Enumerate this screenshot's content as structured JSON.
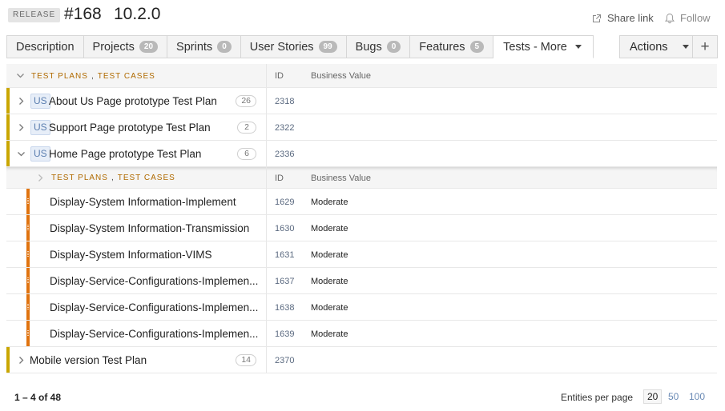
{
  "header": {
    "badge": "RELEASE",
    "id": "#168",
    "name": "10.2.0",
    "share_label": "Share link",
    "follow_label": "Follow"
  },
  "tabs": [
    {
      "label": "Description",
      "count": ""
    },
    {
      "label": "Projects",
      "count": "20"
    },
    {
      "label": "Sprints",
      "count": "0"
    },
    {
      "label": "User Stories",
      "count": "99"
    },
    {
      "label": "Bugs",
      "count": "0"
    },
    {
      "label": "Features",
      "count": "5"
    },
    {
      "label": "Tests - More",
      "count": ""
    }
  ],
  "actions_label": "Actions",
  "plus_label": "+",
  "grid": {
    "group_label_1": "TEST PLANS",
    "group_sep": ",",
    "group_label_2": "TEST CASES",
    "col_id": "ID",
    "col_bv": "Business Value",
    "plans": [
      {
        "type": "US",
        "name": "About Us Page prototype Test Plan",
        "count": "26",
        "id": "2318"
      },
      {
        "type": "US",
        "name": "Support Page prototype Test Plan",
        "count": "2",
        "id": "2322"
      },
      {
        "type": "US",
        "name": "Home Page prototype Test Plan",
        "count": "6",
        "id": "2336"
      }
    ],
    "cases": [
      {
        "name": "Display-System Information-Implement",
        "id": "1629",
        "bv": "Moderate"
      },
      {
        "name": "Display-System Information-Transmission",
        "id": "1630",
        "bv": "Moderate"
      },
      {
        "name": "Display-System Information-VIMS",
        "id": "1631",
        "bv": "Moderate"
      },
      {
        "name": "Display-Service-Configurations-Implemen...",
        "id": "1637",
        "bv": "Moderate"
      },
      {
        "name": "Display-Service-Configurations-Implemen...",
        "id": "1638",
        "bv": "Moderate"
      },
      {
        "name": "Display-Service-Configurations-Implemen...",
        "id": "1639",
        "bv": "Moderate"
      }
    ],
    "last_plan": {
      "name": "Mobile version Test Plan",
      "count": "14",
      "id": "2370"
    }
  },
  "footer": {
    "range": "1 – 4 of 48",
    "epp_label": "Entities per page",
    "options": [
      "20",
      "50",
      "100"
    ]
  },
  "colors": {
    "plan_accent": "#c9a600",
    "case_accent": "#e0730f",
    "group_label": "#b06a00"
  }
}
